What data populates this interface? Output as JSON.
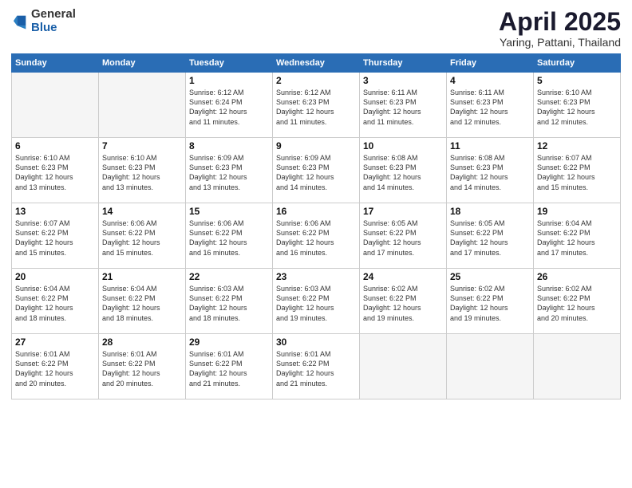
{
  "logo": {
    "general": "General",
    "blue": "Blue"
  },
  "title": "April 2025",
  "subtitle": "Yaring, Pattani, Thailand",
  "days_header": [
    "Sunday",
    "Monday",
    "Tuesday",
    "Wednesday",
    "Thursday",
    "Friday",
    "Saturday"
  ],
  "weeks": [
    [
      {
        "day": "",
        "info": ""
      },
      {
        "day": "",
        "info": ""
      },
      {
        "day": "1",
        "info": "Sunrise: 6:12 AM\nSunset: 6:24 PM\nDaylight: 12 hours\nand 11 minutes."
      },
      {
        "day": "2",
        "info": "Sunrise: 6:12 AM\nSunset: 6:23 PM\nDaylight: 12 hours\nand 11 minutes."
      },
      {
        "day": "3",
        "info": "Sunrise: 6:11 AM\nSunset: 6:23 PM\nDaylight: 12 hours\nand 11 minutes."
      },
      {
        "day": "4",
        "info": "Sunrise: 6:11 AM\nSunset: 6:23 PM\nDaylight: 12 hours\nand 12 minutes."
      },
      {
        "day": "5",
        "info": "Sunrise: 6:10 AM\nSunset: 6:23 PM\nDaylight: 12 hours\nand 12 minutes."
      }
    ],
    [
      {
        "day": "6",
        "info": "Sunrise: 6:10 AM\nSunset: 6:23 PM\nDaylight: 12 hours\nand 13 minutes."
      },
      {
        "day": "7",
        "info": "Sunrise: 6:10 AM\nSunset: 6:23 PM\nDaylight: 12 hours\nand 13 minutes."
      },
      {
        "day": "8",
        "info": "Sunrise: 6:09 AM\nSunset: 6:23 PM\nDaylight: 12 hours\nand 13 minutes."
      },
      {
        "day": "9",
        "info": "Sunrise: 6:09 AM\nSunset: 6:23 PM\nDaylight: 12 hours\nand 14 minutes."
      },
      {
        "day": "10",
        "info": "Sunrise: 6:08 AM\nSunset: 6:23 PM\nDaylight: 12 hours\nand 14 minutes."
      },
      {
        "day": "11",
        "info": "Sunrise: 6:08 AM\nSunset: 6:23 PM\nDaylight: 12 hours\nand 14 minutes."
      },
      {
        "day": "12",
        "info": "Sunrise: 6:07 AM\nSunset: 6:22 PM\nDaylight: 12 hours\nand 15 minutes."
      }
    ],
    [
      {
        "day": "13",
        "info": "Sunrise: 6:07 AM\nSunset: 6:22 PM\nDaylight: 12 hours\nand 15 minutes."
      },
      {
        "day": "14",
        "info": "Sunrise: 6:06 AM\nSunset: 6:22 PM\nDaylight: 12 hours\nand 15 minutes."
      },
      {
        "day": "15",
        "info": "Sunrise: 6:06 AM\nSunset: 6:22 PM\nDaylight: 12 hours\nand 16 minutes."
      },
      {
        "day": "16",
        "info": "Sunrise: 6:06 AM\nSunset: 6:22 PM\nDaylight: 12 hours\nand 16 minutes."
      },
      {
        "day": "17",
        "info": "Sunrise: 6:05 AM\nSunset: 6:22 PM\nDaylight: 12 hours\nand 17 minutes."
      },
      {
        "day": "18",
        "info": "Sunrise: 6:05 AM\nSunset: 6:22 PM\nDaylight: 12 hours\nand 17 minutes."
      },
      {
        "day": "19",
        "info": "Sunrise: 6:04 AM\nSunset: 6:22 PM\nDaylight: 12 hours\nand 17 minutes."
      }
    ],
    [
      {
        "day": "20",
        "info": "Sunrise: 6:04 AM\nSunset: 6:22 PM\nDaylight: 12 hours\nand 18 minutes."
      },
      {
        "day": "21",
        "info": "Sunrise: 6:04 AM\nSunset: 6:22 PM\nDaylight: 12 hours\nand 18 minutes."
      },
      {
        "day": "22",
        "info": "Sunrise: 6:03 AM\nSunset: 6:22 PM\nDaylight: 12 hours\nand 18 minutes."
      },
      {
        "day": "23",
        "info": "Sunrise: 6:03 AM\nSunset: 6:22 PM\nDaylight: 12 hours\nand 19 minutes."
      },
      {
        "day": "24",
        "info": "Sunrise: 6:02 AM\nSunset: 6:22 PM\nDaylight: 12 hours\nand 19 minutes."
      },
      {
        "day": "25",
        "info": "Sunrise: 6:02 AM\nSunset: 6:22 PM\nDaylight: 12 hours\nand 19 minutes."
      },
      {
        "day": "26",
        "info": "Sunrise: 6:02 AM\nSunset: 6:22 PM\nDaylight: 12 hours\nand 20 minutes."
      }
    ],
    [
      {
        "day": "27",
        "info": "Sunrise: 6:01 AM\nSunset: 6:22 PM\nDaylight: 12 hours\nand 20 minutes."
      },
      {
        "day": "28",
        "info": "Sunrise: 6:01 AM\nSunset: 6:22 PM\nDaylight: 12 hours\nand 20 minutes."
      },
      {
        "day": "29",
        "info": "Sunrise: 6:01 AM\nSunset: 6:22 PM\nDaylight: 12 hours\nand 21 minutes."
      },
      {
        "day": "30",
        "info": "Sunrise: 6:01 AM\nSunset: 6:22 PM\nDaylight: 12 hours\nand 21 minutes."
      },
      {
        "day": "",
        "info": ""
      },
      {
        "day": "",
        "info": ""
      },
      {
        "day": "",
        "info": ""
      }
    ]
  ]
}
